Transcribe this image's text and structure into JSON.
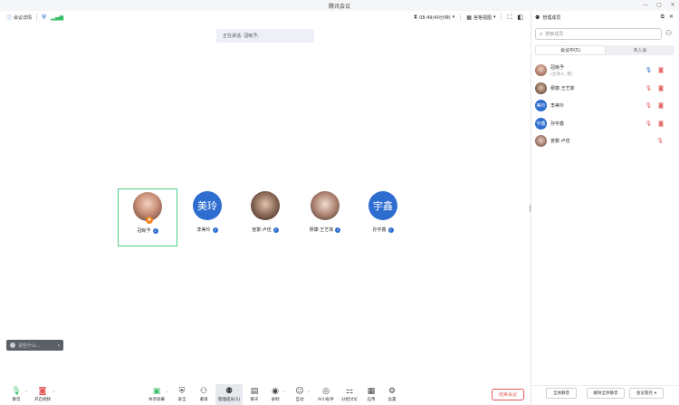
{
  "window": {
    "title": "腾讯会议",
    "controls": [
      "—",
      "▢",
      "✕"
    ]
  },
  "toolbar": {
    "meeting_details": "会议详情",
    "timer": "08:49(40分钟)",
    "view": "宫格视图"
  },
  "speaking": "正在讲话: 冠晰予;",
  "participants_grid": [
    {
      "name": "冠晰予",
      "avatar_text": "",
      "host": true
    },
    {
      "name": "李美玲",
      "avatar_text": "美玲",
      "host": false
    },
    {
      "name": "宫繁·卢佳",
      "avatar_text": "",
      "host": false
    },
    {
      "name": "穆康·王艺菲",
      "avatar_text": "",
      "host": false
    },
    {
      "name": "孙宇鑫",
      "avatar_text": "宇鑫",
      "host": false
    }
  ],
  "chat": {
    "placeholder": "说些什么..."
  },
  "bottom_bar": {
    "mute": "静音",
    "video": "开启视频",
    "share": "共享屏幕",
    "security": "安全",
    "invite": "邀请",
    "members": "管理成员(5)",
    "chat": "聊天",
    "record": "录制",
    "reactions": "互动",
    "ai": "AI小助手",
    "breakout": "分组讨论",
    "apps": "应用",
    "settings": "设置",
    "end": "结束会议"
  },
  "panel": {
    "title": "管理成员",
    "search_placeholder": "搜索成员",
    "tab_in_meeting": "会议中(5)",
    "tab_not_joined": "未入会",
    "members": [
      {
        "name": "冠晰予",
        "sub": "(主持人, 我)",
        "avatar_text": ""
      },
      {
        "name": "穆康·王艺菲",
        "sub": "",
        "avatar_text": ""
      },
      {
        "name": "李美玲",
        "sub": "",
        "avatar_text": "美玲"
      },
      {
        "name": "孙宇鑫",
        "sub": "",
        "avatar_text": "宇鑫"
      },
      {
        "name": "宫繁·卢佳",
        "sub": "",
        "avatar_text": ""
      }
    ],
    "mute_all": "全体静音",
    "unmute_all": "解除全体静音",
    "more": "会议管控"
  }
}
